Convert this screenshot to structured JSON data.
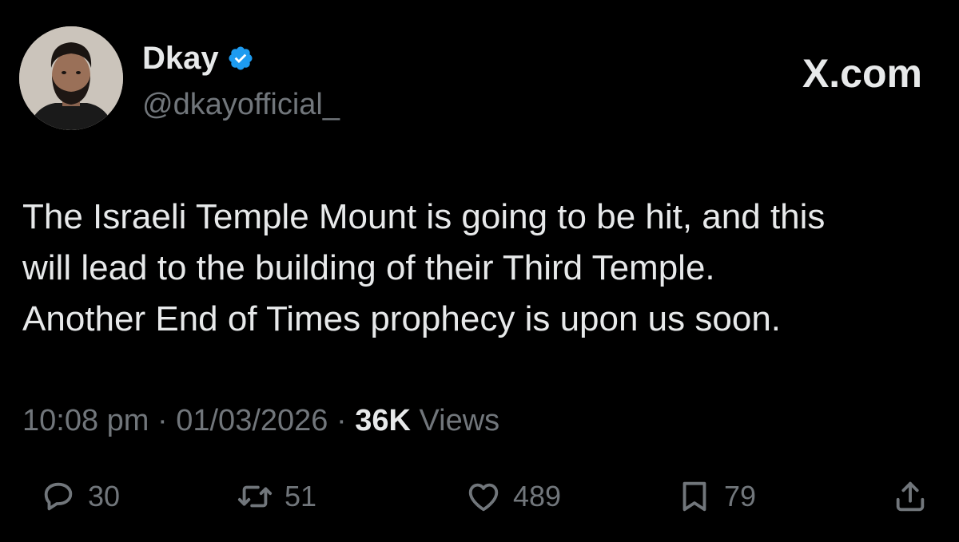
{
  "user": {
    "display_name": "Dkay",
    "handle": "@dkayofficial_",
    "verified": true
  },
  "brand": {
    "label": "X.com"
  },
  "tweet": {
    "lines": [
      "The Israeli Temple Mount is going to be hit, and this",
      "will lead to the building of their Third Temple.",
      "Another End of Times prophecy is upon us soon."
    ],
    "time": "10:08 pm",
    "date": "01/03/2026",
    "views_count": "36K",
    "views_label": "Views",
    "separator": "·"
  },
  "actions": {
    "replies": "30",
    "reposts": "51",
    "likes": "489",
    "bookmarks": "79"
  },
  "colors": {
    "background": "#000000",
    "text_primary": "#e7e9ea",
    "text_secondary": "#71767b",
    "verified_blue": "#1d9bf0"
  },
  "icons": [
    "verified-badge-icon",
    "reply-icon",
    "repost-icon",
    "like-icon",
    "bookmark-icon",
    "share-icon"
  ]
}
